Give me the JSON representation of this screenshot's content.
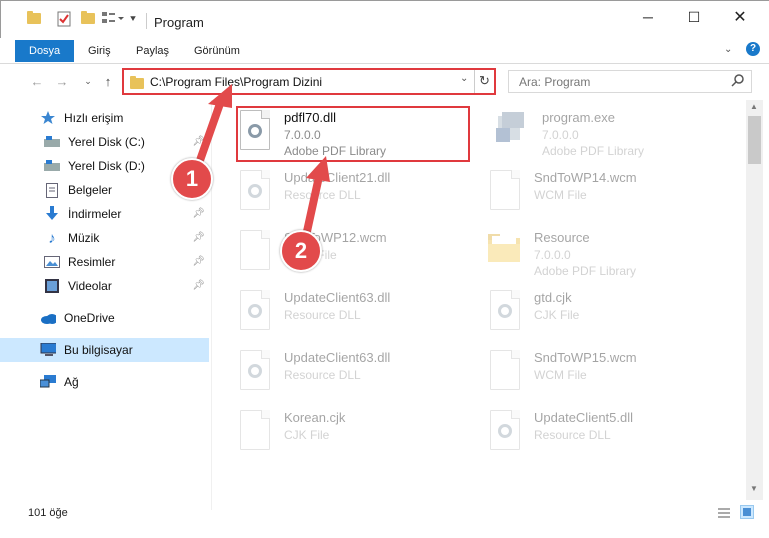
{
  "window": {
    "title": "Program",
    "colors": {
      "accent": "#1979ca",
      "highlight": "#e0393e",
      "selection": "#cce8ff"
    }
  },
  "ribbon": {
    "tabs": [
      {
        "label": "Dosya"
      },
      {
        "label": "Giriş"
      },
      {
        "label": "Paylaş"
      },
      {
        "label": "Görünüm"
      }
    ]
  },
  "address": {
    "path": "C:\\Program Files\\Program Dizini",
    "search_placeholder": "Ara: Program"
  },
  "sidebar": {
    "items": [
      {
        "label": "Hızlı erişim",
        "icon": "star-icon"
      },
      {
        "label": "Yerel Disk (C:)",
        "icon": "drive-icon"
      },
      {
        "label": "Yerel Disk (D:)",
        "icon": "drive-icon"
      },
      {
        "label": "Belgeler",
        "icon": "documents-icon"
      },
      {
        "label": "İndirmeler",
        "icon": "download-icon"
      },
      {
        "label": "Müzik",
        "icon": "music-icon"
      },
      {
        "label": "Resimler",
        "icon": "pictures-icon"
      },
      {
        "label": "Videolar",
        "icon": "video-icon"
      },
      {
        "label": "OneDrive",
        "icon": "cloud-icon"
      },
      {
        "label": "Bu bilgisayar",
        "icon": "computer-icon"
      },
      {
        "label": "Ağ",
        "icon": "network-icon"
      }
    ]
  },
  "files": [
    {
      "name": "pdfl70.dll",
      "line1": "7.0.0.0",
      "line2": "Adobe PDF Library",
      "icon": "dll-icon"
    },
    {
      "name": "program.exe",
      "line1": "7.0.0.0",
      "line2": "Adobe PDF Library",
      "icon": "exe-icon"
    },
    {
      "name": "UpdateClient21.dll",
      "line1": "Resource DLL",
      "icon": "dll-icon"
    },
    {
      "name": "SndToWP14.wcm",
      "line1": "WCM File",
      "icon": "file-icon"
    },
    {
      "name": "SndToWP12.wcm",
      "line1": "WCM File",
      "icon": "file-icon"
    },
    {
      "name": "Resource",
      "line1": "7.0.0.0",
      "line2": "Adobe PDF Library",
      "icon": "folder-icon"
    },
    {
      "name": "UpdateClient63.dll",
      "line1": "Resource DLL",
      "icon": "dll-icon"
    },
    {
      "name": "gtd.cjk",
      "line1": "CJK File",
      "icon": "dll-icon"
    },
    {
      "name": "UpdateClient63.dll",
      "line1": "Resource DLL",
      "icon": "dll-icon"
    },
    {
      "name": "SndToWP15.wcm",
      "line1": "WCM File",
      "icon": "file-icon"
    },
    {
      "name": "Korean.cjk",
      "line1": "CJK File",
      "icon": "file-icon"
    },
    {
      "name": "UpdateClient5.dll",
      "line1": "Resource DLL",
      "icon": "dll-icon"
    }
  ],
  "annotations": {
    "badge1": "1",
    "badge2": "2"
  },
  "status": {
    "count": "101 öğe"
  }
}
